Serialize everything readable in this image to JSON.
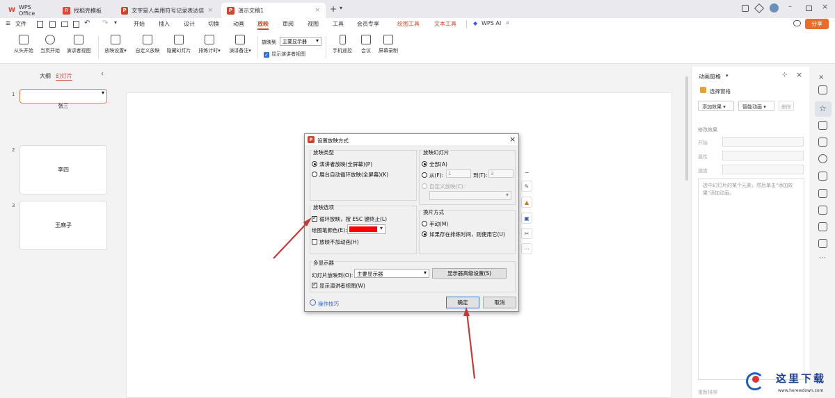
{
  "tabs": [
    {
      "label": "WPS Office",
      "logo": "W"
    },
    {
      "label": "找稻壳模板",
      "logo": "R"
    },
    {
      "label": "文字是人类用符号记录表达信息以",
      "logo": "P"
    },
    {
      "label": "演示文稿1",
      "logo": "P"
    }
  ],
  "menu": {
    "file": "文件",
    "items": [
      "开始",
      "插入",
      "设计",
      "切换",
      "动画",
      "放映",
      "审阅",
      "视图",
      "工具",
      "会员专享",
      "绘图工具",
      "文本工具"
    ],
    "wpsai": "WPS AI",
    "share": "分享"
  },
  "ribbon": {
    "buttons": [
      "从头开始",
      "当页开始",
      "演讲者视图",
      "放映设置",
      "自定义放映",
      "隐藏幻灯片",
      "排练计时",
      "演讲备注",
      "手机遥控",
      "会议",
      "屏幕录制"
    ],
    "show_on_label": "放映到",
    "show_on_value": "主要显示器",
    "presenter_view": "显示演讲者视图"
  },
  "left_panel": {
    "tab_outline": "大纲",
    "tab_slides": "幻灯片",
    "slides": [
      {
        "num": "1",
        "text": "张三"
      },
      {
        "num": "2",
        "text": "李四"
      },
      {
        "num": "3",
        "text": "王麻子"
      }
    ]
  },
  "right_panel": {
    "title": "动画窗格",
    "select_pane": "选择窗格",
    "add_effect": "添加效果",
    "smart_anim": "智能动画",
    "delete": "删除",
    "modify": "修改效果",
    "start": "开始",
    "property": "属性",
    "speed": "速度",
    "hint": "选中幻灯片的某个元素，然后单击\"添加效果\"添加动画。",
    "reorder": "重新排序"
  },
  "dialog": {
    "title": "设置放映方式",
    "type_group": "放映类型",
    "type_presenter": "演讲者放映(全屏幕)(P)",
    "type_kiosk": "展台自动循环放映(全屏幕)(K)",
    "slides_group": "放映幻灯片",
    "all": "全部(A)",
    "from": "从(F):",
    "from_val": "1",
    "to": "到(T):",
    "to_val": "3",
    "custom": "自定义放映(C):",
    "options_group": "放映选项",
    "loop": "循环放映，按 ESC 键终止(L)",
    "pen_color": "绘图笔颜色(E):",
    "pen_color_value": "#ff0000",
    "no_anim": "放映不加动画(H)",
    "advance_group": "换片方式",
    "manual": "手动(M)",
    "timings": "如果存在排练时间，则使用它(U)",
    "multi_group": "多显示器",
    "show_on": "幻灯片放映到(O):",
    "show_on_value": "主要显示器",
    "adv_btn": "显示器高级设置(S)",
    "presenter": "显示演讲者视图(W)",
    "tips": "操作技巧",
    "ok": "确定",
    "cancel": "取消"
  },
  "watermark": {
    "title": "这里下载",
    "url": "www.herewdown.com"
  }
}
